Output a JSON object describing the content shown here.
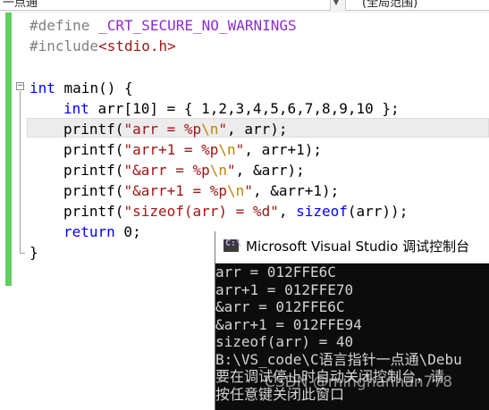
{
  "toolbar": {
    "scope_left": "一点通",
    "scope_right": "(全局范围)"
  },
  "code": {
    "define_kw": "#define",
    "define_macro": " _CRT_SECURE_NO_WARNINGS",
    "include_kw": "#include",
    "include_file": "<stdio.h>",
    "main_int": "int",
    "main_rest": " main() {",
    "arr_int": "int",
    "arr_rest": " arr[10] = { 1,2,3,4,5,6,7,8,9,10 };",
    "p1_fn": "printf(",
    "p1_str_a": "\"arr = %p",
    "p1_esc": "\\n",
    "p1_str_b": "\"",
    "p1_rest": ", arr);",
    "p2_fn": "printf(",
    "p2_str_a": "\"arr+1 = %p",
    "p2_esc": "\\n",
    "p2_str_b": "\"",
    "p2_rest": ", arr+1);",
    "p3_fn": "printf(",
    "p3_str_a": "\"&arr = %p",
    "p3_esc": "\\n",
    "p3_str_b": "\"",
    "p3_rest": ", &arr);",
    "p4_fn": "printf(",
    "p4_str_a": "\"&arr+1 = %p",
    "p4_esc": "\\n",
    "p4_str_b": "\"",
    "p4_rest": ", &arr+1);",
    "p5_fn": "printf(",
    "p5_str": "\"sizeof(arr) = %d\"",
    "p5_mid": ", ",
    "p5_kw": "sizeof",
    "p5_rest": "(arr));",
    "ret_kw": "return",
    "ret_rest": " 0;",
    "close_brace": "}"
  },
  "console": {
    "title": "Microsoft Visual Studio 调试控制台",
    "icon": "visual-studio-icon",
    "lines": [
      "arr = 012FFE6C",
      "arr+1 = 012FFE70",
      "&arr = 012FFE6C",
      "&arr+1 = 012FFE94",
      "sizeof(arr) = 40",
      "B:\\VS_code\\C语言指针一点通\\Debu",
      "要在调试停止时自动关闭控制台，请",
      "按任意键关闭此窗口"
    ]
  },
  "watermark": "CSDN @minghanhan778",
  "colors": {
    "keyword": "#0000ff",
    "string": "#a31515",
    "escape": "#b8860b",
    "macro": "#8b2fc9",
    "preprocessor": "#808080",
    "gutter_changed": "#5fd05f",
    "console_bg": "#0c0c0c",
    "console_text": "#d4d4d4"
  }
}
